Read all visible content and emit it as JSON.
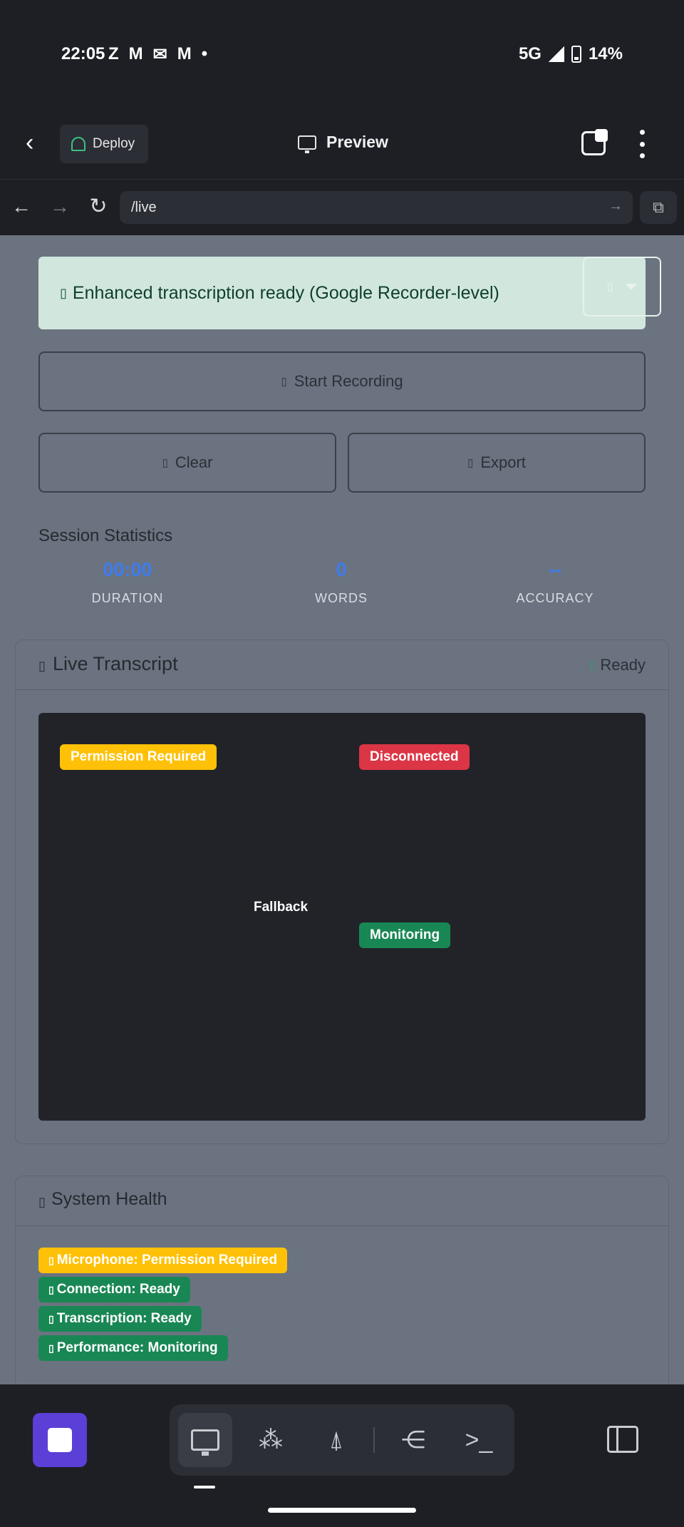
{
  "status_bar": {
    "time": "22:05",
    "notif_icons": [
      "Z",
      "M",
      "✉",
      "M",
      "•"
    ],
    "network": "5G",
    "battery": "14%"
  },
  "app_bar": {
    "deploy_label": "Deploy",
    "title": "Preview"
  },
  "url_bar": {
    "url": "/live"
  },
  "page": {
    "alert": {
      "glyph": "▯",
      "text": "Enhanced transcription ready (Google Recorder-level)",
      "dropdown_glyph": "▯"
    },
    "buttons": {
      "start_glyph": "▯",
      "start_label": "Start Recording",
      "clear_glyph": "▯",
      "clear_label": "Clear",
      "export_glyph": "▯",
      "export_label": "Export"
    },
    "stats": {
      "title": "Session Statistics",
      "items": [
        {
          "value": "00:00",
          "label": "DURATION"
        },
        {
          "value": "0",
          "label": "WORDS"
        },
        {
          "value": "--",
          "label": "ACCURACY"
        }
      ]
    },
    "transcript": {
      "glyph": "▯",
      "title": "Live Transcript",
      "status_glyph": "▯",
      "status": "Ready",
      "badges": {
        "permission": "Permission Required",
        "disconnected": "Disconnected",
        "monitoring": "Monitoring"
      },
      "fallback": "Fallback"
    },
    "health": {
      "glyph": "▯",
      "title": "System Health",
      "items": [
        {
          "glyph": "▯",
          "label": "Microphone: Permission Required",
          "color": "#ffc107"
        },
        {
          "glyph": "▯",
          "label": "Connection: Ready",
          "color": "#198754"
        },
        {
          "glyph": "▯",
          "label": "Transcription: Ready",
          "color": "#198754"
        },
        {
          "glyph": "▯",
          "label": "Performance: Monitoring",
          "color": "#198754"
        }
      ]
    }
  },
  "bottom_nav": {
    "tools": [
      "desktop-icon",
      "apps-icon",
      "deploy-icon",
      "workflow-icon",
      "terminal-icon"
    ],
    "terminal_glyph": ">_"
  },
  "colors": {
    "accent_purple": "#5b3fd6",
    "stat_blue": "#3d7cf0",
    "success": "#198754",
    "warning": "#ffc107",
    "danger": "#dc3545"
  }
}
